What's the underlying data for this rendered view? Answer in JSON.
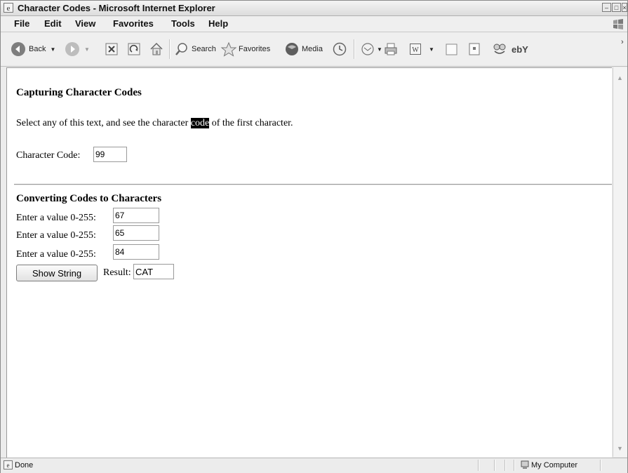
{
  "window": {
    "title": "Character Codes - Microsoft Internet Explorer",
    "controls": [
      "minimize",
      "maximize",
      "close"
    ]
  },
  "menu": {
    "items": [
      "File",
      "Edit",
      "View",
      "Favorites",
      "Tools",
      "Help"
    ]
  },
  "toolbar": {
    "back_label": "Back",
    "search_label": "Search",
    "favorites_label": "Favorites",
    "media_label": "Media",
    "icons": [
      "back-icon",
      "forward-icon",
      "stop-icon",
      "refresh-icon",
      "home-icon",
      "search-icon",
      "favorites-star-icon",
      "media-icon",
      "history-icon",
      "mail-icon",
      "print-icon",
      "word-icon",
      "discuss-icon",
      "messenger-icon",
      "research-icon",
      "ebay-icon"
    ],
    "ebay_text": "ebY"
  },
  "page": {
    "section1_heading": "Capturing Character Codes",
    "para_before": "Select any of this text, and see the character ",
    "selected_word": "code",
    "para_after": " of the first character.",
    "char_code_label": "Character Code:",
    "char_code_value": "99",
    "section2_heading": "Converting Codes to Characters",
    "inputs": [
      {
        "label": "Enter a value 0-255:",
        "value": "67"
      },
      {
        "label": "Enter a value 0-255:",
        "value": "65"
      },
      {
        "label": "Enter a value 0-255:",
        "value": "84"
      }
    ],
    "button_label": "Show String",
    "result_label": "Result:",
    "result_value": "CAT"
  },
  "status": {
    "left_text": "Done",
    "zone_text": "My Computer"
  }
}
